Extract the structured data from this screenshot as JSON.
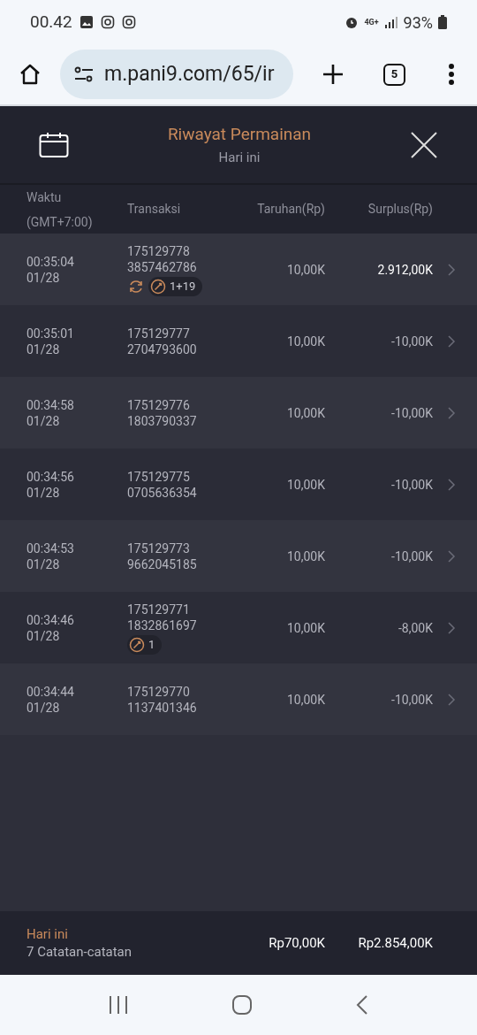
{
  "status_bar": {
    "time": "00.42",
    "network": "4G+",
    "battery": "93%"
  },
  "browser": {
    "url": "m.pani9.com/65/ir",
    "tab_count": "5"
  },
  "header": {
    "title": "Riwayat Permainan",
    "subtitle": "Hari ini"
  },
  "table": {
    "columns": [
      {
        "label": "Waktu",
        "sublabel": "(GMT+7:00)"
      },
      {
        "label": "Transaksi"
      },
      {
        "label": "Taruhan(Rp)"
      },
      {
        "label": "Surplus(Rp)"
      }
    ],
    "rows": [
      {
        "time": "00:35:04",
        "date": "01/28",
        "id1": "175129778",
        "id2": "3857462786",
        "badges": [
          {
            "kind": "refresh"
          },
          {
            "kind": "spin",
            "count": "1+19"
          }
        ],
        "bet": "10,00K",
        "surplus": "2.912,00K",
        "highlighted": true
      },
      {
        "time": "00:35:01",
        "date": "01/28",
        "id1": "175129777",
        "id2": "2704793600",
        "badges": [],
        "bet": "10,00K",
        "surplus": "-10,00K",
        "highlighted": false
      },
      {
        "time": "00:34:58",
        "date": "01/28",
        "id1": "175129776",
        "id2": "1803790337",
        "badges": [],
        "bet": "10,00K",
        "surplus": "-10,00K",
        "highlighted": false
      },
      {
        "time": "00:34:56",
        "date": "01/28",
        "id1": "175129775",
        "id2": "0705636354",
        "badges": [],
        "bet": "10,00K",
        "surplus": "-10,00K",
        "highlighted": false
      },
      {
        "time": "00:34:53",
        "date": "01/28",
        "id1": "175129773",
        "id2": "9662045185",
        "badges": [],
        "bet": "10,00K",
        "surplus": "-10,00K",
        "highlighted": false
      },
      {
        "time": "00:34:46",
        "date": "01/28",
        "id1": "175129771",
        "id2": "1832861697",
        "badges": [
          {
            "kind": "spin",
            "count": "1"
          }
        ],
        "bet": "10,00K",
        "surplus": "-8,00K",
        "highlighted": false
      },
      {
        "time": "00:34:44",
        "date": "01/28",
        "id1": "175129770",
        "id2": "1137401346",
        "badges": [],
        "bet": "10,00K",
        "surplus": "-10,00K",
        "highlighted": false
      }
    ]
  },
  "footer": {
    "period": "Hari ini",
    "count": "7 Catatan-catatan",
    "total_bet": "Rp70,00K",
    "total_surplus": "Rp2.854,00K"
  }
}
